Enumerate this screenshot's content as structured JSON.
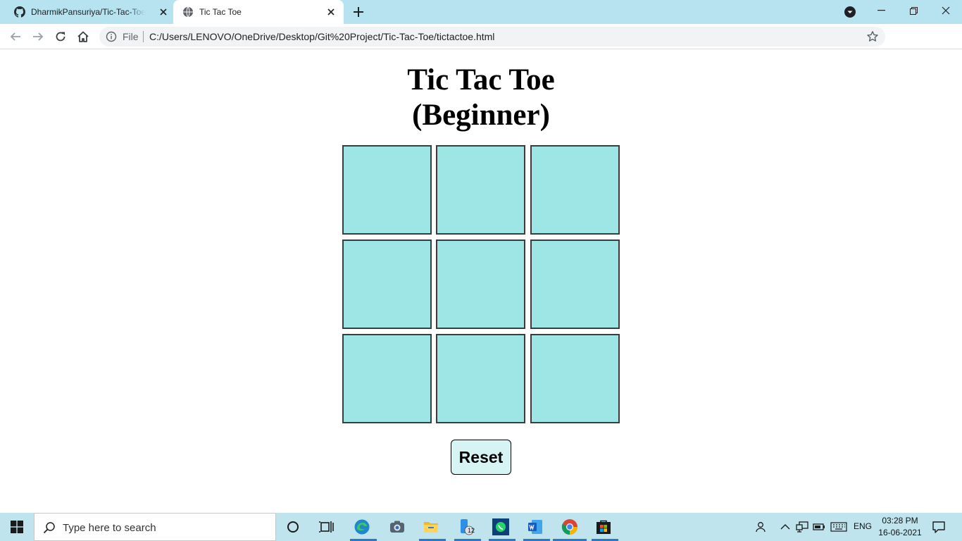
{
  "browser": {
    "tabs": [
      {
        "title": "DharmikPansuriya/Tic-Tac-Toe: I c",
        "active": false,
        "favicon": "github-icon"
      },
      {
        "title": "Tic Tac Toe",
        "active": true,
        "favicon": "globe-icon"
      }
    ],
    "omnibox": {
      "security_chip": "File",
      "url": "C:/Users/LENOVO/OneDrive/Desktop/Git%20Project/Tic-Tac-Toe/tictactoe.html"
    }
  },
  "page": {
    "title_line1": "Tic Tac Toe",
    "title_line2": "(Beginner)",
    "board": {
      "cells": [
        "",
        "",
        "",
        "",
        "",
        "",
        "",
        "",
        ""
      ],
      "cell_color": "#9ee5e5"
    },
    "reset_label": "Reset"
  },
  "taskbar": {
    "search_placeholder": "Type here to search",
    "apps": [
      "cortana-icon",
      "task-view-icon",
      "edge-icon",
      "camera-icon",
      "file-explorer-icon",
      "phone-icon",
      "whatsapp-icon",
      "word-icon",
      "chrome-icon",
      "store-icon"
    ],
    "phone_badge": "12",
    "language": "ENG",
    "time": "03:28 PM",
    "date": "16-06-2021"
  },
  "colors": {
    "tabstrip": "#b6e3ef",
    "taskbar": "#bfe4ee",
    "accent": "#2b78c9",
    "reset_bg": "#d6f4f4"
  }
}
